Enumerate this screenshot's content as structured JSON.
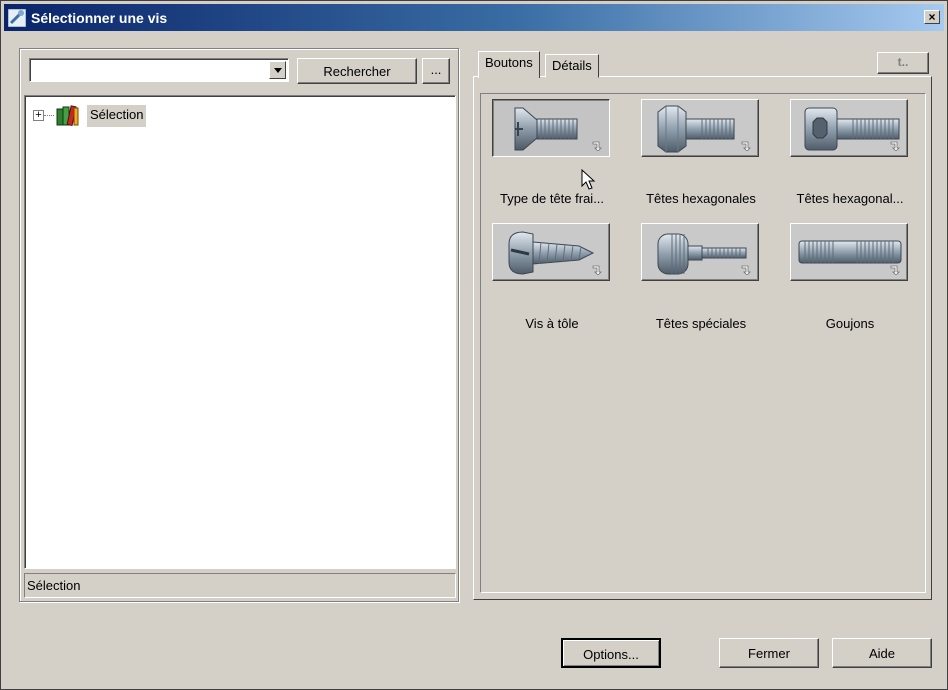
{
  "window": {
    "title": "Sélectionner une vis",
    "close_glyph": "×"
  },
  "search": {
    "value": "",
    "button_label": "Rechercher",
    "browse_label": "..."
  },
  "tree": {
    "root_label": "Sélection",
    "expander_glyph": "+"
  },
  "status": {
    "text": "Sélection"
  },
  "tabs": [
    {
      "label": "Boutons",
      "active": true
    },
    {
      "label": "Détails",
      "active": false
    }
  ],
  "nav_up_label": "t..",
  "tiles": [
    {
      "label": "Type de tête frai...",
      "icon": "countersunk-phillips-screw-icon"
    },
    {
      "label": "Têtes hexagonales",
      "icon": "hex-head-bolt-icon"
    },
    {
      "label": "Têtes hexagonal...",
      "icon": "socket-head-cap-screw-icon"
    },
    {
      "label": "Vis à tôle",
      "icon": "sheet-metal-screw-icon"
    },
    {
      "label": "Têtes spéciales",
      "icon": "knurled-thumb-screw-icon"
    },
    {
      "label": "Goujons",
      "icon": "stud-bolt-icon"
    }
  ],
  "buttons": {
    "options": "Options...",
    "close": "Fermer",
    "help": "Aide"
  },
  "colors": {
    "titlebar_start": "#0a246a",
    "titlebar_end": "#a6caf0",
    "face": "#d4d0c8"
  }
}
